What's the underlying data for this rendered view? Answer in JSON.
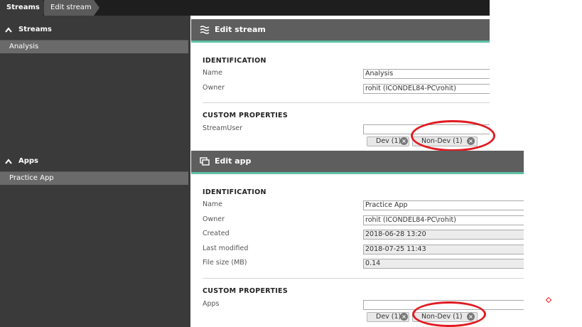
{
  "breadcrumb": {
    "items": [
      "Streams",
      "Edit stream"
    ]
  },
  "left_panels": {
    "streams": {
      "title": "Streams",
      "item": "Analysis"
    },
    "apps": {
      "title": "Apps",
      "item": "Practice App"
    }
  },
  "edit_stream": {
    "title": "Edit stream",
    "identification_label": "IDENTIFICATION",
    "name_label": "Name",
    "name_value": "Analysis",
    "owner_label": "Owner",
    "owner_value": "rohit (ICONDEL84-PC\\rohit)",
    "custom_properties_label": "CUSTOM PROPERTIES",
    "streamuser_label": "StreamUser",
    "tags": [
      "Dev (1)",
      "Non-Dev (1)"
    ]
  },
  "edit_app": {
    "title": "Edit app",
    "identification_label": "IDENTIFICATION",
    "name_label": "Name",
    "name_value": "Practice App",
    "owner_label": "Owner",
    "owner_value": "rohit (ICONDEL84-PC\\rohit)",
    "created_label": "Created",
    "created_value": "2018-06-28 13:20",
    "modified_label": "Last modified",
    "modified_value": "2018-07-25 11:43",
    "filesize_label": "File size (MB)",
    "filesize_value": "0.14",
    "custom_properties_label": "CUSTOM PROPERTIES",
    "apps_label": "Apps",
    "tags": [
      "Dev (1)",
      "Non-Dev (1)"
    ]
  },
  "colors": {
    "accent": "#5dbfa4",
    "highlight_circle": "#e01b22",
    "header": "#5e5e5e",
    "sidebar": "#3a3a3a"
  }
}
